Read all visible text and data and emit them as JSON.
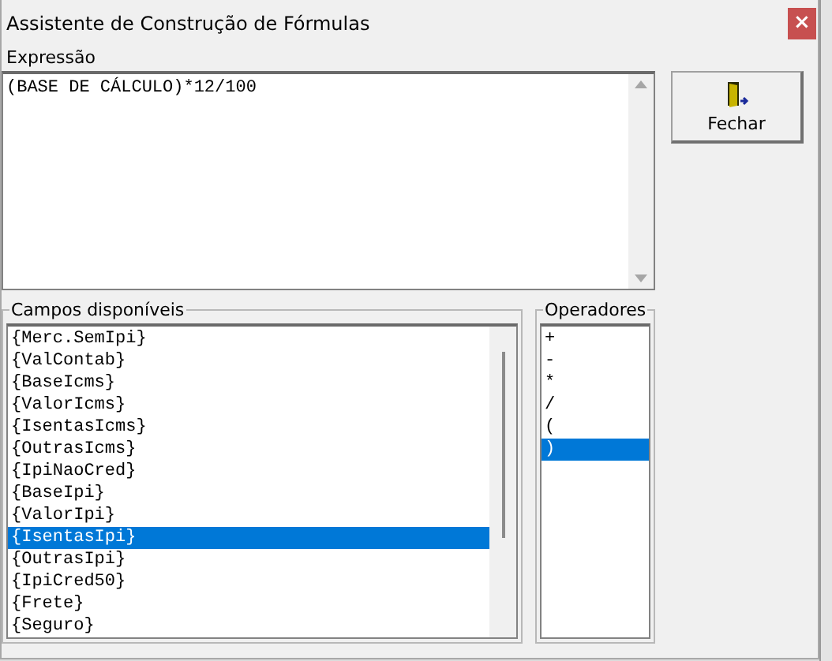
{
  "window": {
    "title": "Assistente de Construção de Fórmulas",
    "close": "×"
  },
  "expression": {
    "label": "Expressão",
    "value": "(BASE DE CÁLCULO)*12/100"
  },
  "close_button": {
    "label": "Fechar"
  },
  "fields": {
    "title": "Campos disponíveis",
    "items": [
      {
        "label": "{Merc.SemIpi}",
        "selected": false
      },
      {
        "label": "{ValContab}",
        "selected": false
      },
      {
        "label": "{BaseIcms}",
        "selected": false
      },
      {
        "label": "{ValorIcms}",
        "selected": false
      },
      {
        "label": "{IsentasIcms}",
        "selected": false
      },
      {
        "label": "{OutrasIcms}",
        "selected": false
      },
      {
        "label": "{IpiNaoCred}",
        "selected": false
      },
      {
        "label": "{BaseIpi}",
        "selected": false
      },
      {
        "label": "{ValorIpi}",
        "selected": false
      },
      {
        "label": "{IsentasIpi}",
        "selected": true
      },
      {
        "label": "{OutrasIpi}",
        "selected": false
      },
      {
        "label": "{IpiCred50}",
        "selected": false
      },
      {
        "label": "{Frete}",
        "selected": false
      },
      {
        "label": "{Seguro}",
        "selected": false
      }
    ]
  },
  "operators": {
    "title": "Operadores",
    "items": [
      {
        "label": "+",
        "selected": false
      },
      {
        "label": "-",
        "selected": false
      },
      {
        "label": "*",
        "selected": false
      },
      {
        "label": "/",
        "selected": false
      },
      {
        "label": "(",
        "selected": false
      },
      {
        "label": ")",
        "selected": true
      }
    ]
  }
}
